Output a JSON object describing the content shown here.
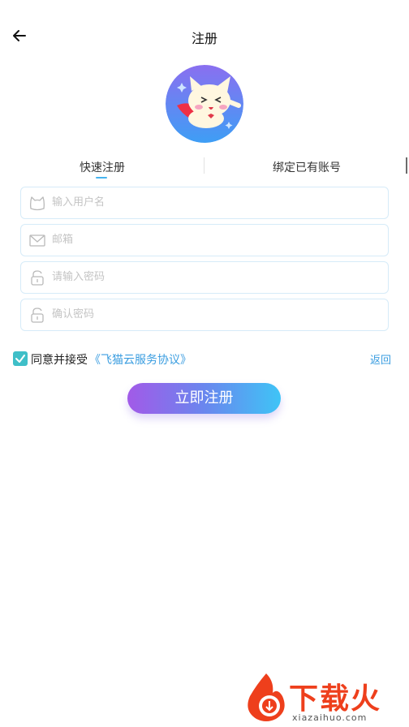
{
  "header": {
    "title": "注册",
    "back_icon": "arrow-left-icon"
  },
  "avatar": {
    "icon": "flying-cat-logo"
  },
  "tabs": [
    {
      "label": "快速注册",
      "active": true
    },
    {
      "label": "绑定已有账号",
      "active": false
    }
  ],
  "form": {
    "username": {
      "placeholder": "输入用户名",
      "value": "",
      "icon": "cat-icon"
    },
    "email": {
      "placeholder": "邮箱",
      "value": "",
      "icon": "mail-icon"
    },
    "password": {
      "placeholder": "请输入密码",
      "value": "",
      "icon": "lock-icon"
    },
    "confirm": {
      "placeholder": "确认密码",
      "value": "",
      "icon": "lock-icon"
    }
  },
  "agreement": {
    "checked": true,
    "text": "同意并接受",
    "link": "《飞猫云服务协议》",
    "return_label": "返回"
  },
  "submit_label": "立即注册",
  "watermark": {
    "title": "下载火",
    "subtitle": "xiazaihuo.com"
  },
  "colors": {
    "accent": "#46b4ef",
    "link": "#3a9de0",
    "check": "#3fbfc8",
    "border": "#d6ebf8",
    "gradient_start": "#a25ae8",
    "gradient_end": "#3fc4f6",
    "watermark": "#ee3f1c"
  }
}
